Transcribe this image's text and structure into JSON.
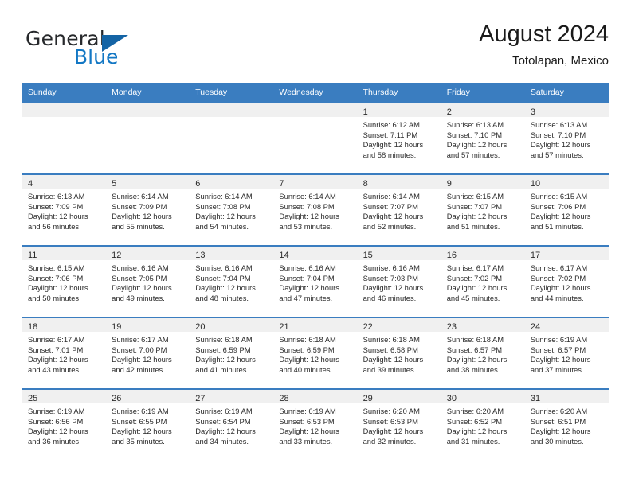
{
  "brand": {
    "word1": "General",
    "word2": "Blue",
    "logo_icon": "triangle-logo-icon",
    "accent_color": "#1277c4",
    "triangle_color": "#1464a5"
  },
  "header": {
    "title": "August 2024",
    "subtitle": "Totolapan, Mexico"
  },
  "calendar": {
    "header_bg": "#3a7dc0",
    "daynum_bg": "#f0f0f0",
    "weekdays": [
      "Sunday",
      "Monday",
      "Tuesday",
      "Wednesday",
      "Thursday",
      "Friday",
      "Saturday"
    ],
    "weeks": [
      [
        {
          "day": "",
          "lines": []
        },
        {
          "day": "",
          "lines": []
        },
        {
          "day": "",
          "lines": []
        },
        {
          "day": "",
          "lines": []
        },
        {
          "day": "1",
          "lines": [
            "Sunrise: 6:12 AM",
            "Sunset: 7:11 PM",
            "Daylight: 12 hours",
            "and 58 minutes."
          ]
        },
        {
          "day": "2",
          "lines": [
            "Sunrise: 6:13 AM",
            "Sunset: 7:10 PM",
            "Daylight: 12 hours",
            "and 57 minutes."
          ]
        },
        {
          "day": "3",
          "lines": [
            "Sunrise: 6:13 AM",
            "Sunset: 7:10 PM",
            "Daylight: 12 hours",
            "and 57 minutes."
          ]
        }
      ],
      [
        {
          "day": "4",
          "lines": [
            "Sunrise: 6:13 AM",
            "Sunset: 7:09 PM",
            "Daylight: 12 hours",
            "and 56 minutes."
          ]
        },
        {
          "day": "5",
          "lines": [
            "Sunrise: 6:14 AM",
            "Sunset: 7:09 PM",
            "Daylight: 12 hours",
            "and 55 minutes."
          ]
        },
        {
          "day": "6",
          "lines": [
            "Sunrise: 6:14 AM",
            "Sunset: 7:08 PM",
            "Daylight: 12 hours",
            "and 54 minutes."
          ]
        },
        {
          "day": "7",
          "lines": [
            "Sunrise: 6:14 AM",
            "Sunset: 7:08 PM",
            "Daylight: 12 hours",
            "and 53 minutes."
          ]
        },
        {
          "day": "8",
          "lines": [
            "Sunrise: 6:14 AM",
            "Sunset: 7:07 PM",
            "Daylight: 12 hours",
            "and 52 minutes."
          ]
        },
        {
          "day": "9",
          "lines": [
            "Sunrise: 6:15 AM",
            "Sunset: 7:07 PM",
            "Daylight: 12 hours",
            "and 51 minutes."
          ]
        },
        {
          "day": "10",
          "lines": [
            "Sunrise: 6:15 AM",
            "Sunset: 7:06 PM",
            "Daylight: 12 hours",
            "and 51 minutes."
          ]
        }
      ],
      [
        {
          "day": "11",
          "lines": [
            "Sunrise: 6:15 AM",
            "Sunset: 7:06 PM",
            "Daylight: 12 hours",
            "and 50 minutes."
          ]
        },
        {
          "day": "12",
          "lines": [
            "Sunrise: 6:16 AM",
            "Sunset: 7:05 PM",
            "Daylight: 12 hours",
            "and 49 minutes."
          ]
        },
        {
          "day": "13",
          "lines": [
            "Sunrise: 6:16 AM",
            "Sunset: 7:04 PM",
            "Daylight: 12 hours",
            "and 48 minutes."
          ]
        },
        {
          "day": "14",
          "lines": [
            "Sunrise: 6:16 AM",
            "Sunset: 7:04 PM",
            "Daylight: 12 hours",
            "and 47 minutes."
          ]
        },
        {
          "day": "15",
          "lines": [
            "Sunrise: 6:16 AM",
            "Sunset: 7:03 PM",
            "Daylight: 12 hours",
            "and 46 minutes."
          ]
        },
        {
          "day": "16",
          "lines": [
            "Sunrise: 6:17 AM",
            "Sunset: 7:02 PM",
            "Daylight: 12 hours",
            "and 45 minutes."
          ]
        },
        {
          "day": "17",
          "lines": [
            "Sunrise: 6:17 AM",
            "Sunset: 7:02 PM",
            "Daylight: 12 hours",
            "and 44 minutes."
          ]
        }
      ],
      [
        {
          "day": "18",
          "lines": [
            "Sunrise: 6:17 AM",
            "Sunset: 7:01 PM",
            "Daylight: 12 hours",
            "and 43 minutes."
          ]
        },
        {
          "day": "19",
          "lines": [
            "Sunrise: 6:17 AM",
            "Sunset: 7:00 PM",
            "Daylight: 12 hours",
            "and 42 minutes."
          ]
        },
        {
          "day": "20",
          "lines": [
            "Sunrise: 6:18 AM",
            "Sunset: 6:59 PM",
            "Daylight: 12 hours",
            "and 41 minutes."
          ]
        },
        {
          "day": "21",
          "lines": [
            "Sunrise: 6:18 AM",
            "Sunset: 6:59 PM",
            "Daylight: 12 hours",
            "and 40 minutes."
          ]
        },
        {
          "day": "22",
          "lines": [
            "Sunrise: 6:18 AM",
            "Sunset: 6:58 PM",
            "Daylight: 12 hours",
            "and 39 minutes."
          ]
        },
        {
          "day": "23",
          "lines": [
            "Sunrise: 6:18 AM",
            "Sunset: 6:57 PM",
            "Daylight: 12 hours",
            "and 38 minutes."
          ]
        },
        {
          "day": "24",
          "lines": [
            "Sunrise: 6:19 AM",
            "Sunset: 6:57 PM",
            "Daylight: 12 hours",
            "and 37 minutes."
          ]
        }
      ],
      [
        {
          "day": "25",
          "lines": [
            "Sunrise: 6:19 AM",
            "Sunset: 6:56 PM",
            "Daylight: 12 hours",
            "and 36 minutes."
          ]
        },
        {
          "day": "26",
          "lines": [
            "Sunrise: 6:19 AM",
            "Sunset: 6:55 PM",
            "Daylight: 12 hours",
            "and 35 minutes."
          ]
        },
        {
          "day": "27",
          "lines": [
            "Sunrise: 6:19 AM",
            "Sunset: 6:54 PM",
            "Daylight: 12 hours",
            "and 34 minutes."
          ]
        },
        {
          "day": "28",
          "lines": [
            "Sunrise: 6:19 AM",
            "Sunset: 6:53 PM",
            "Daylight: 12 hours",
            "and 33 minutes."
          ]
        },
        {
          "day": "29",
          "lines": [
            "Sunrise: 6:20 AM",
            "Sunset: 6:53 PM",
            "Daylight: 12 hours",
            "and 32 minutes."
          ]
        },
        {
          "day": "30",
          "lines": [
            "Sunrise: 6:20 AM",
            "Sunset: 6:52 PM",
            "Daylight: 12 hours",
            "and 31 minutes."
          ]
        },
        {
          "day": "31",
          "lines": [
            "Sunrise: 6:20 AM",
            "Sunset: 6:51 PM",
            "Daylight: 12 hours",
            "and 30 minutes."
          ]
        }
      ]
    ]
  }
}
